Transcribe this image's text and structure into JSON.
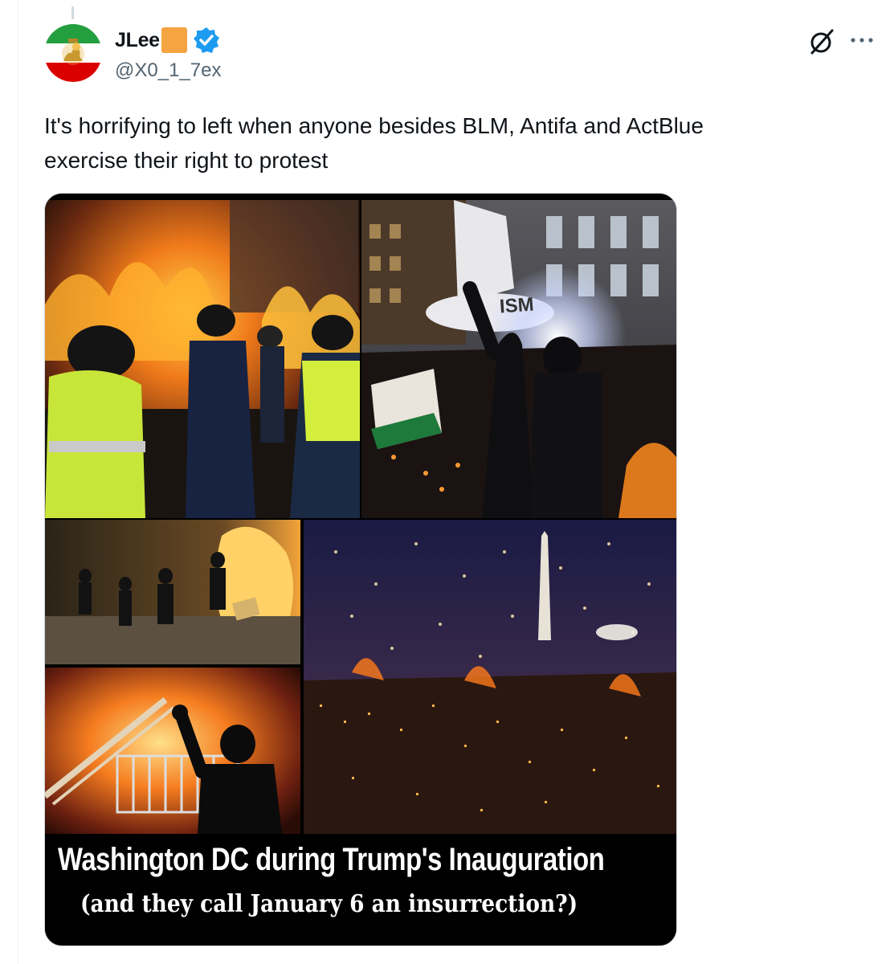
{
  "post": {
    "author_name": "JLee",
    "author_handle": "@X0_1_7ex",
    "text_line1": "It's horrifying to left when anyone besides BLM, Antifa and ActBlue",
    "text_line2": "exercise their right to protest"
  },
  "icons": {
    "verified": "verified-badge-icon",
    "grok": "grok-icon",
    "more": "more-options-icon",
    "flag_emoji_color": "#f4a441",
    "verified_color": "#1d9bf0"
  },
  "media": {
    "sign_text": "ISM",
    "caption_title": "Washington DC during Trump's Inauguration",
    "caption_subtitle": "(and they call January 6 an insurrection?)"
  }
}
